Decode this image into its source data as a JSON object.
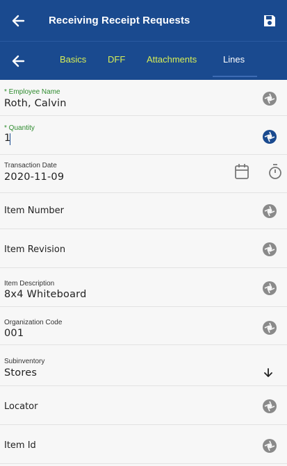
{
  "header": {
    "title": "Receiving Receipt Requests",
    "back_icon": "arrow-left-icon",
    "save_icon": "save-icon"
  },
  "tabs": [
    {
      "label": "Basics",
      "active": false
    },
    {
      "label": "DFF",
      "active": false
    },
    {
      "label": "Attachments",
      "active": false
    },
    {
      "label": "Lines",
      "active": true
    }
  ],
  "fields": {
    "employee": {
      "label": "* Employee Name",
      "value": "Roth, Calvin"
    },
    "quantity": {
      "label": "* Quantity",
      "value": "1"
    },
    "transaction_date": {
      "label": "Transaction Date",
      "value": "2020-11-09"
    },
    "item_number": {
      "label": "Item Number"
    },
    "item_revision": {
      "label": "Item Revision"
    },
    "item_description": {
      "label": "Item Description",
      "value": "8x4 Whiteboard"
    },
    "organization_code": {
      "label": "Organization Code",
      "value": "001"
    },
    "subinventory": {
      "label": "Subinventory",
      "value": "Stores"
    },
    "locator": {
      "label": "Locator"
    },
    "item_id": {
      "label": "Item Id"
    }
  },
  "colors": {
    "header_bg": "#1a4a8f",
    "tab_inactive": "#d7ee56",
    "tab_active": "#ffffff",
    "required_label": "#2e8b2e",
    "icon_gray": "#8a8a8a",
    "icon_active": "#1a4a8f"
  }
}
